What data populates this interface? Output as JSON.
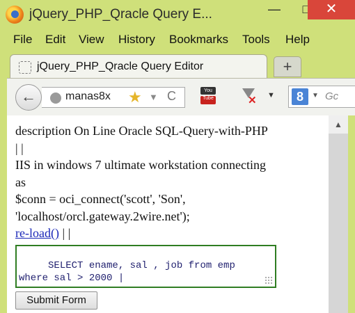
{
  "window": {
    "title": "jQuery_PHP_Qracle Query E...",
    "minimize": "—",
    "maximize": "□",
    "close": "✕",
    "logo_icon": "firefox-logo-icon"
  },
  "menu": {
    "items": [
      "File",
      "Edit",
      "View",
      "History",
      "Bookmarks",
      "Tools",
      "Help"
    ]
  },
  "tabs": {
    "active_label": "jQuery_PHP_Qracle Query Editor",
    "new_tab": "+"
  },
  "navbar": {
    "back": "←",
    "url": "manas8x",
    "bookmark_star": "★",
    "dropdown": "▼",
    "reload": "C",
    "youtube_label": "You Tube",
    "download_menu": "▼",
    "search_engine": "8",
    "search_dropdown": "▼",
    "search_placeholder": "Gc"
  },
  "page": {
    "lines": [
      "description On Line Oracle SQL-Query-with-PHP",
      "| |",
      "IIS in windows 7 ultimate workstation connecting",
      "as",
      "$conn = oci_connect('scott', 'Son',",
      "'localhost/orcl.gateway.2wire.net');"
    ],
    "reload_link": "re-load()",
    "after_link": "| |",
    "sql_text": " SELECT ename, sal , job from emp\nwhere sal > 2000 |",
    "submit_label": "Submit Form"
  },
  "scrollbar": {
    "up_arrow": "▲"
  }
}
